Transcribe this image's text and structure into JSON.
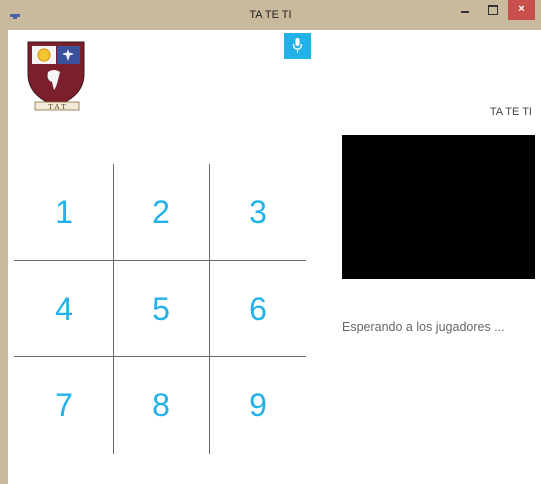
{
  "window": {
    "title": "TA TE TI",
    "close_glyph": "×"
  },
  "app": {
    "title": "TA TE TI",
    "status": "Esperando a los jugadores ...",
    "accent": "#21b2e8"
  },
  "logo": {
    "text": "T A T"
  },
  "board": {
    "cells": [
      "1",
      "2",
      "3",
      "4",
      "5",
      "6",
      "7",
      "8",
      "9"
    ]
  },
  "icons": {
    "mic": "microphone-icon",
    "system": "window-menu-icon"
  }
}
